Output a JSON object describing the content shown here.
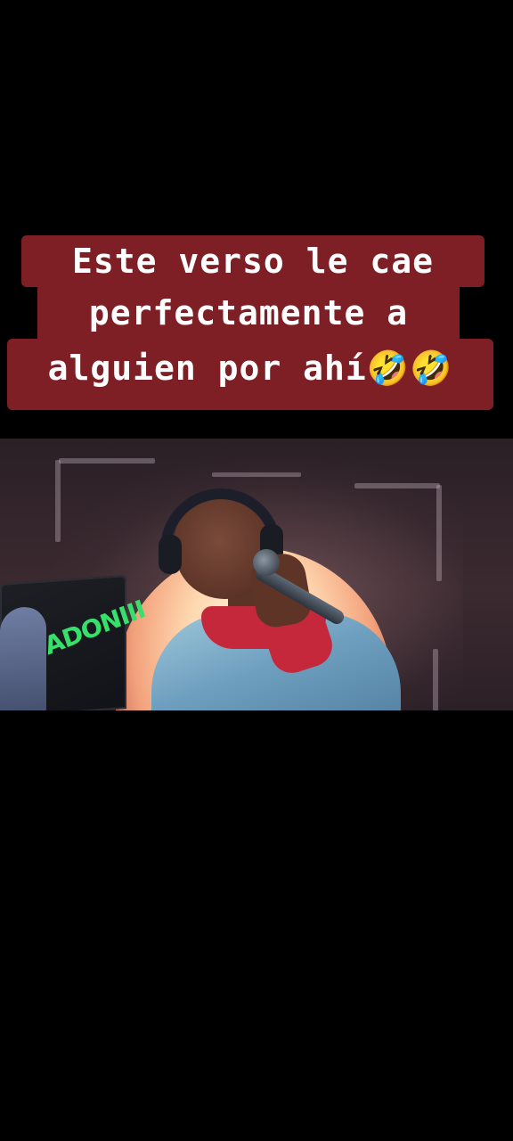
{
  "caption": {
    "line1": "Este verso le cae",
    "line2": "perfectamente a",
    "line3": "alguien por ahí🤣🤣",
    "background_color": "#7d1f24",
    "text_color": "#ffffff"
  },
  "video": {
    "laptop_sticker_text": "ADONIII"
  }
}
